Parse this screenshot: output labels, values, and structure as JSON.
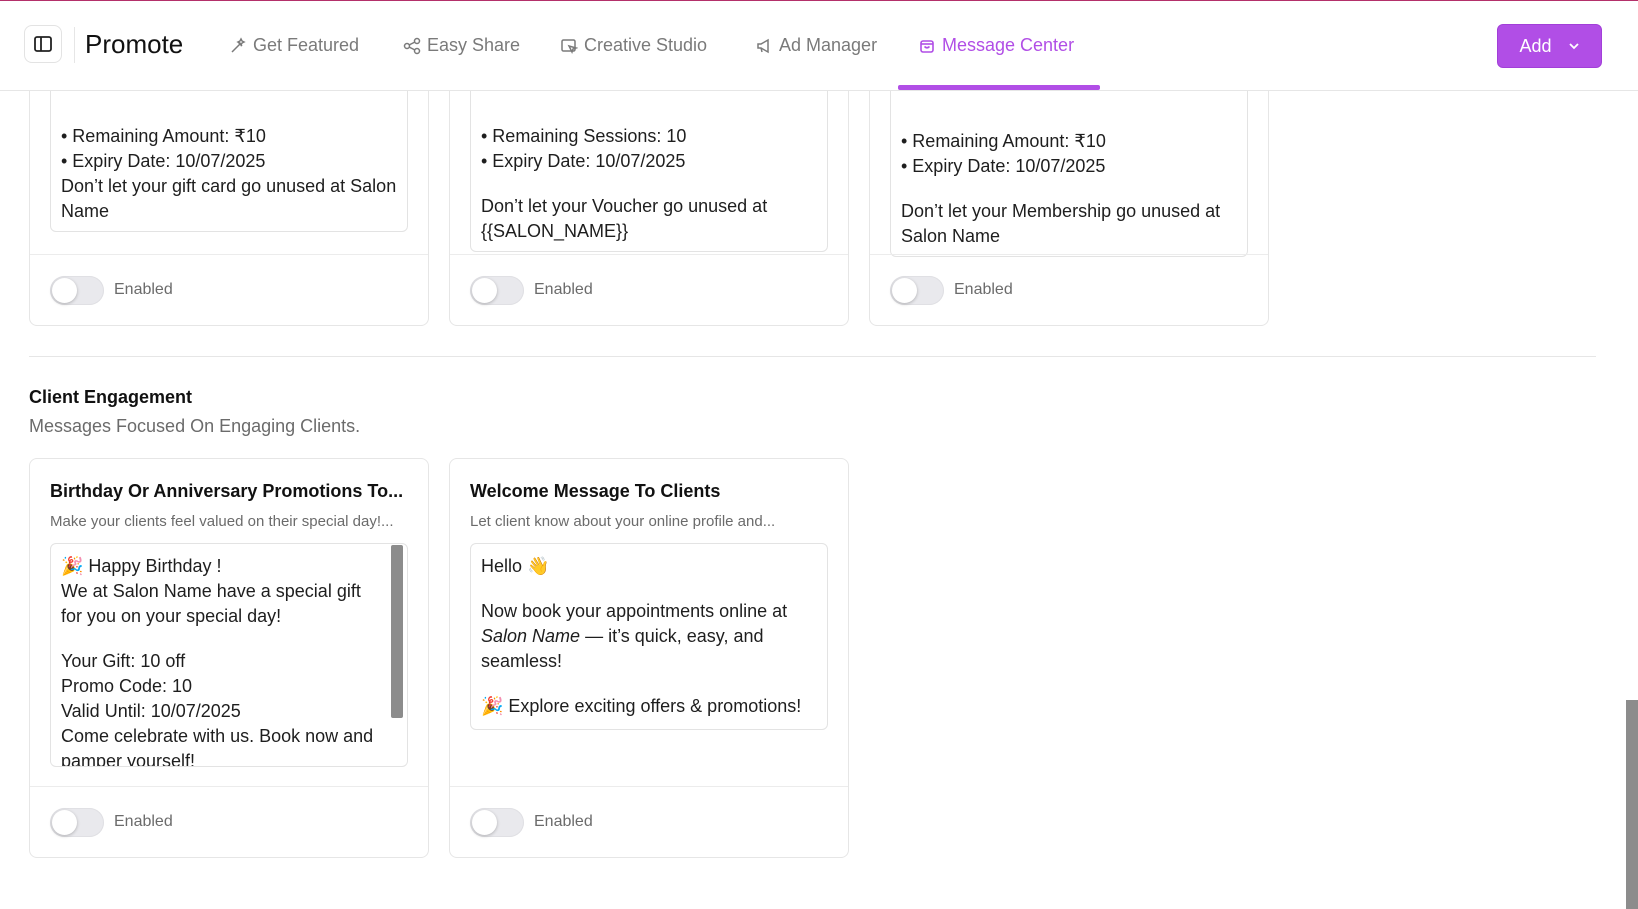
{
  "header": {
    "brand": "Promote",
    "nav": [
      {
        "label": "Get Featured"
      },
      {
        "label": "Easy Share"
      },
      {
        "label": "Creative Studio"
      },
      {
        "label": "Ad Manager"
      },
      {
        "label": "Message Center"
      }
    ],
    "active_tab": "Message Center",
    "add_label": "Add",
    "accent_color": "#b14ee6"
  },
  "top_cards": [
    {
      "lines": [
        "• Remaining Amount: ₹10",
        "• Expiry Date: 10/07/2025",
        "Don’t let your gift card go unused at Salon Name"
      ],
      "toggle_label": "Enabled",
      "enabled": false
    },
    {
      "lines": [
        "• Remaining Sessions: 10",
        "• Expiry Date: 10/07/2025",
        "Don’t let your Voucher go unused at {{SALON_NAME}}"
      ],
      "toggle_label": "Enabled",
      "enabled": false
    },
    {
      "lines": [
        "• Remaining Amount: ₹10",
        "• Expiry Date: 10/07/2025",
        "Don’t let your Membership go unused at Salon Name"
      ],
      "toggle_label": "Enabled",
      "enabled": false
    }
  ],
  "section": {
    "title": "Client Engagement",
    "subtitle": "Messages Focused On Engaging Clients."
  },
  "engagement_cards": [
    {
      "title": "Birthday Or Anniversary Promotions To...",
      "description": "Make your clients feel valued on their special day!...",
      "message": {
        "greeting": "🎉 Happy Birthday !",
        "body": "We at Salon Name have a special gift for you on your special day!",
        "gift": "Your Gift: 10 off",
        "promo": "Promo Code: 10",
        "valid": "Valid Until: 10/07/2025",
        "closing": "Come celebrate with us. Book now and pamper yourself!"
      },
      "toggle_label": "Enabled",
      "enabled": false
    },
    {
      "title": "Welcome Message To Clients",
      "description": "Let client know about your online profile and...",
      "message": {
        "greeting": "Hello 👋",
        "body_prefix": "Now book your appointments online at",
        "salon": "Salon Name",
        "body_suffix": " — it’s quick, easy, and seamless!",
        "promo": "🎉 Explore exciting offers & promotions!"
      },
      "toggle_label": "Enabled",
      "enabled": false
    }
  ]
}
